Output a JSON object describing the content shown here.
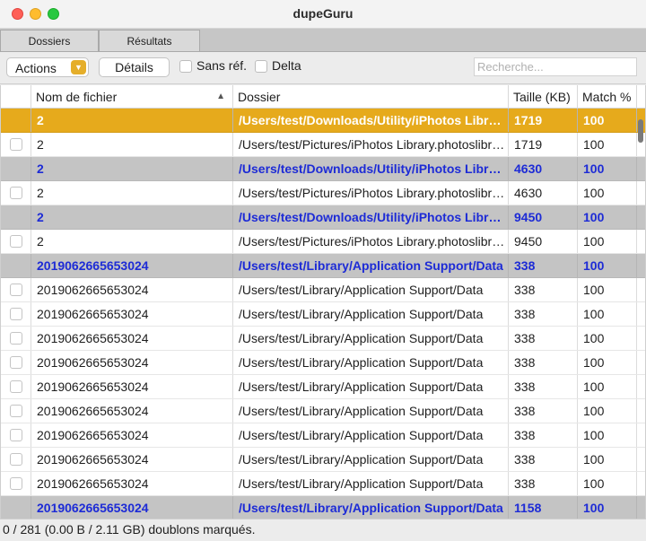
{
  "window": {
    "title": "dupeGuru"
  },
  "tabs": [
    {
      "label": "Dossiers"
    },
    {
      "label": "Résultats"
    }
  ],
  "toolbar": {
    "actions_label": "Actions",
    "details_label": "Détails",
    "sans_ref_label": "Sans réf.",
    "delta_label": "Delta",
    "search_placeholder": "Recherche..."
  },
  "columns": {
    "name": "Nom de fichier",
    "folder": "Dossier",
    "size": "Taille (KB)",
    "match": "Match %"
  },
  "rows": [
    {
      "type": "sel",
      "name": "2",
      "folder": "/Users/test/Downloads/Utility/iPhotos Library.photoslibrary",
      "size": "1719",
      "match": "100"
    },
    {
      "type": "dupe",
      "name": "2",
      "folder": "/Users/test/Pictures/iPhotos Library.photoslibrary",
      "size": "1719",
      "match": "100"
    },
    {
      "type": "ref",
      "name": "2",
      "folder": "/Users/test/Downloads/Utility/iPhotos Library.photoslibrary",
      "size": "4630",
      "match": "100"
    },
    {
      "type": "dupe",
      "name": "2",
      "folder": "/Users/test/Pictures/iPhotos Library.photoslibrary",
      "size": "4630",
      "match": "100"
    },
    {
      "type": "ref",
      "name": "2",
      "folder": "/Users/test/Downloads/Utility/iPhotos Library.photoslibrary",
      "size": "9450",
      "match": "100"
    },
    {
      "type": "dupe",
      "name": "2",
      "folder": "/Users/test/Pictures/iPhotos Library.photoslibrary",
      "size": "9450",
      "match": "100"
    },
    {
      "type": "ref",
      "name": "2019062665653024",
      "folder": "/Users/test/Library/Application Support/Data",
      "size": "338",
      "match": "100"
    },
    {
      "type": "dupe",
      "name": "2019062665653024",
      "folder": "/Users/test/Library/Application Support/Data",
      "size": "338",
      "match": "100"
    },
    {
      "type": "dupe",
      "name": "2019062665653024",
      "folder": "/Users/test/Library/Application Support/Data",
      "size": "338",
      "match": "100"
    },
    {
      "type": "dupe",
      "name": "2019062665653024",
      "folder": "/Users/test/Library/Application Support/Data",
      "size": "338",
      "match": "100"
    },
    {
      "type": "dupe",
      "name": "2019062665653024",
      "folder": "/Users/test/Library/Application Support/Data",
      "size": "338",
      "match": "100"
    },
    {
      "type": "dupe",
      "name": "2019062665653024",
      "folder": "/Users/test/Library/Application Support/Data",
      "size": "338",
      "match": "100"
    },
    {
      "type": "dupe",
      "name": "2019062665653024",
      "folder": "/Users/test/Library/Application Support/Data",
      "size": "338",
      "match": "100"
    },
    {
      "type": "dupe",
      "name": "2019062665653024",
      "folder": "/Users/test/Library/Application Support/Data",
      "size": "338",
      "match": "100"
    },
    {
      "type": "dupe",
      "name": "2019062665653024",
      "folder": "/Users/test/Library/Application Support/Data",
      "size": "338",
      "match": "100"
    },
    {
      "type": "dupe",
      "name": "2019062665653024",
      "folder": "/Users/test/Library/Application Support/Data",
      "size": "338",
      "match": "100"
    },
    {
      "type": "ref",
      "name": "2019062665653024",
      "folder": "/Users/test/Library/Application Support/Data",
      "size": "1158",
      "match": "100"
    }
  ],
  "status": {
    "text": "0 / 281 (0.00 B / 2.11 GB) doublons marqués."
  },
  "colors": {
    "selection": "#e6aa1c",
    "reference_bg": "#c4c4c4",
    "reference_text": "#1d2bd6"
  }
}
